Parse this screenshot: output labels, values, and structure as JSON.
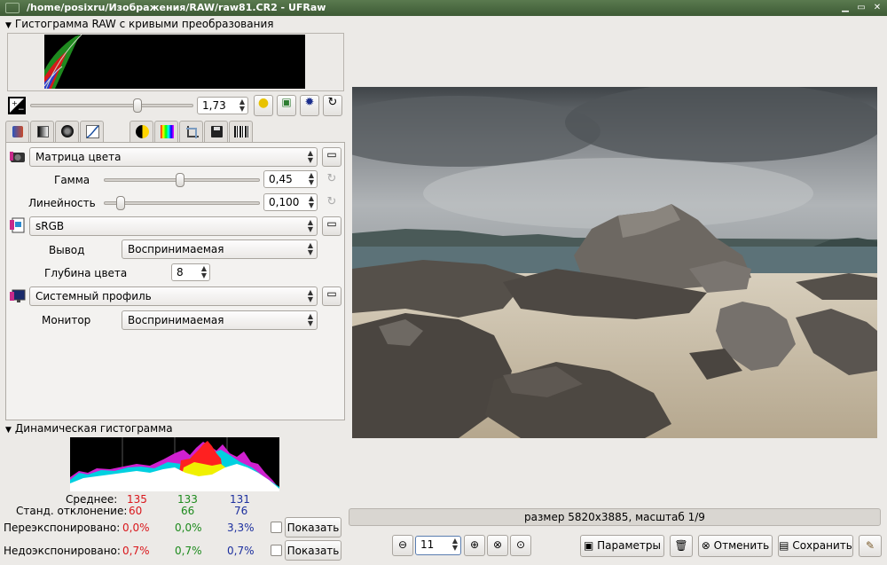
{
  "window": {
    "title": "/home/posixru/Изображения/RAW/raw81.CR2 - UFRaw"
  },
  "raw_histogram": {
    "title": "Гистограмма RAW с кривыми преобразования"
  },
  "exposure": {
    "value": "1,73",
    "slider_fraction": 0.62
  },
  "tabs": [
    {
      "name": "white-balance",
      "icon": "wb-icon",
      "color": "#c84a2a"
    },
    {
      "name": "grayscale",
      "icon": "grayscale-icon",
      "color": "#555555"
    },
    {
      "name": "lens",
      "icon": "lens-icon",
      "color": "#333333"
    },
    {
      "name": "base-curve",
      "icon": "curve-icon",
      "color": "#3a6fb0"
    },
    {
      "name": "color-management",
      "icon": "color-management-icon",
      "color": "#2eb82e"
    },
    {
      "name": "correction",
      "icon": "correction-icon",
      "color": "#e0a800"
    },
    {
      "name": "lightness",
      "icon": "rainbow-icon",
      "color": "#ff3300"
    },
    {
      "name": "crop",
      "icon": "crop-icon",
      "color": "#8a8a8a"
    },
    {
      "name": "save",
      "icon": "floppy-icon",
      "color": "#333333"
    },
    {
      "name": "exif",
      "icon": "barcode-icon",
      "color": "#222222"
    }
  ],
  "color_mgmt": {
    "input_profile": "Матрица цвета",
    "gamma_label": "Гамма",
    "gamma_value": "0,45",
    "gamma_fraction": 0.45,
    "linearity_label": "Линейность",
    "linearity_value": "0,100",
    "linearity_fraction": 0.05,
    "output_profile": "sRGB",
    "output_label": "Вывод",
    "output_intent": "Воспринимаемая",
    "depth_label": "Глубина цвета",
    "depth_value": "8",
    "display_profile": "Системный профиль",
    "monitor_label": "Монитор",
    "monitor_intent": "Воспринимаемая"
  },
  "live_histogram": {
    "title": "Динамическая гистограмма"
  },
  "stats": {
    "mean_label": "Среднее:",
    "mean": [
      "135",
      "133",
      "131"
    ],
    "std_label": "Станд. отклонение:",
    "std": [
      "60",
      "66",
      "76"
    ],
    "over_label": "Переэкспонировано:",
    "over": [
      "0,0%",
      "0,0%",
      "3,3%"
    ],
    "under_label": "Недоэкспонировано:",
    "under": [
      "0,7%",
      "0,7%",
      "0,7%"
    ],
    "show_label": "Показать"
  },
  "status": {
    "text": "размер 5820x3885, масштаб 1/9"
  },
  "zoom": {
    "value": "11"
  },
  "buttons": {
    "options": "Параметры",
    "cancel": "Отменить",
    "save": "Сохранить"
  },
  "colors": {
    "red": "#d9161b",
    "green": "#1c8a1c",
    "blue": "#1c2f9e"
  }
}
